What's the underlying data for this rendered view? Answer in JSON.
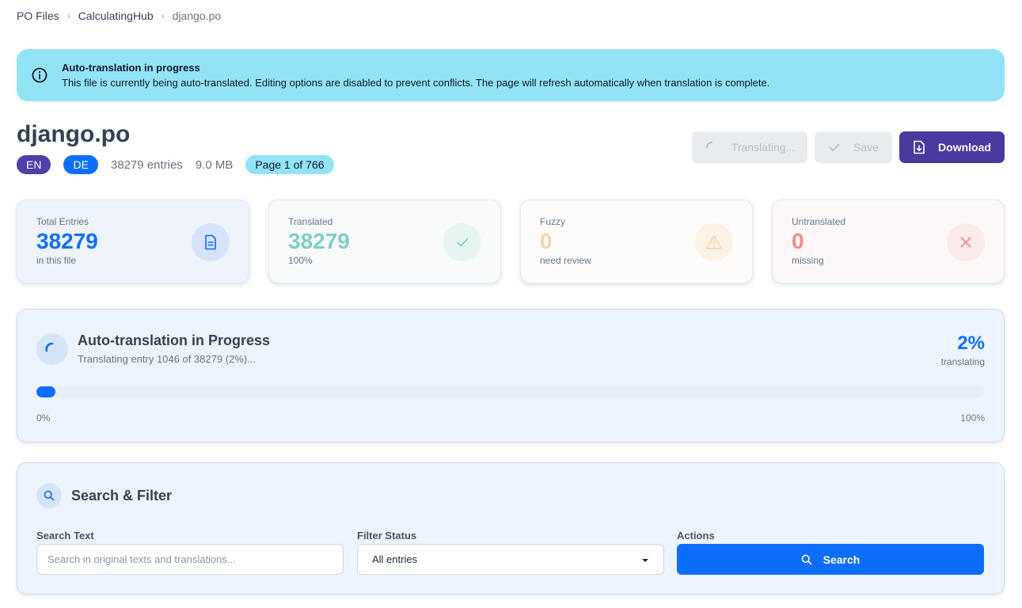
{
  "breadcrumb": [
    "PO Files",
    "CalculatingHub",
    "django.po"
  ],
  "alert": {
    "title": "Auto-translation in progress",
    "message": "This file is currently being auto-translated. Editing options are disabled to prevent conflicts. The page will refresh automatically when translation is complete."
  },
  "file": {
    "name": "django.po",
    "source_lang": "EN",
    "target_lang": "DE",
    "entries": "38279 entries",
    "size": "9.0 MB",
    "page": "Page 1 of 766"
  },
  "actions": {
    "translating": "Translating...",
    "save": "Save",
    "download": "Download"
  },
  "stats": {
    "total": {
      "label": "Total Entries",
      "value": "38279",
      "sub": "in this file"
    },
    "translated": {
      "label": "Translated",
      "value": "38279",
      "sub": "100%"
    },
    "fuzzy": {
      "label": "Fuzzy",
      "value": "0",
      "sub": "need review"
    },
    "untranslated": {
      "label": "Untranslated",
      "value": "0",
      "sub": "missing"
    }
  },
  "progress": {
    "title": "Auto-translation in Progress",
    "subtitle": "Translating entry 1046 of 38279 (2%)...",
    "percent_label": "2%",
    "percent_value": 2,
    "status": "translating",
    "min_label": "0%",
    "max_label": "100%"
  },
  "filter": {
    "title": "Search & Filter",
    "search_label": "Search Text",
    "search_placeholder": "Search in original texts and translations...",
    "status_label": "Filter Status",
    "status_value": "All entries",
    "actions_label": "Actions",
    "search_button": "Search"
  },
  "colors": {
    "primary": "#0d6efd",
    "indigo": "#4a3aa0",
    "info": "#93e3f7"
  }
}
